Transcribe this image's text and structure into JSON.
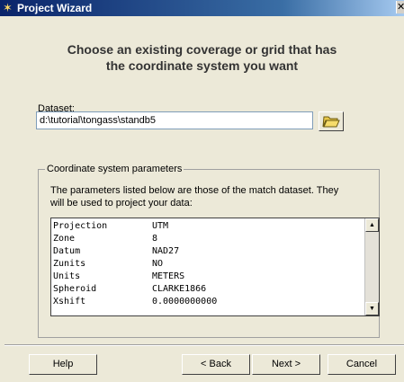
{
  "window": {
    "title": "Project Wizard",
    "icon": "wizard-icon",
    "close_glyph": "✕"
  },
  "heading": {
    "line1": "Choose an existing coverage or grid that has",
    "line2": "the coordinate system you want"
  },
  "dataset": {
    "label": "Dataset:",
    "value": "d:\\tutorial\\tongass\\standb5",
    "browse_icon": "folder-open-icon"
  },
  "params": {
    "group_title": "Coordinate system parameters",
    "desc_line1": "The parameters listed below are those of the match dataset.  They",
    "desc_line2": "will be used to project your data:",
    "rows": [
      {
        "key": "Projection",
        "value": "UTM"
      },
      {
        "key": "Zone",
        "value": "8"
      },
      {
        "key": "Datum",
        "value": "NAD27"
      },
      {
        "key": "Zunits",
        "value": "NO"
      },
      {
        "key": "Units",
        "value": "METERS"
      },
      {
        "key": "Spheroid",
        "value": "CLARKE1866"
      },
      {
        "key": "Xshift",
        "value": "0.0000000000"
      }
    ]
  },
  "buttons": {
    "help": "Help",
    "back": "< Back",
    "next": "Next >",
    "cancel": "Cancel"
  }
}
